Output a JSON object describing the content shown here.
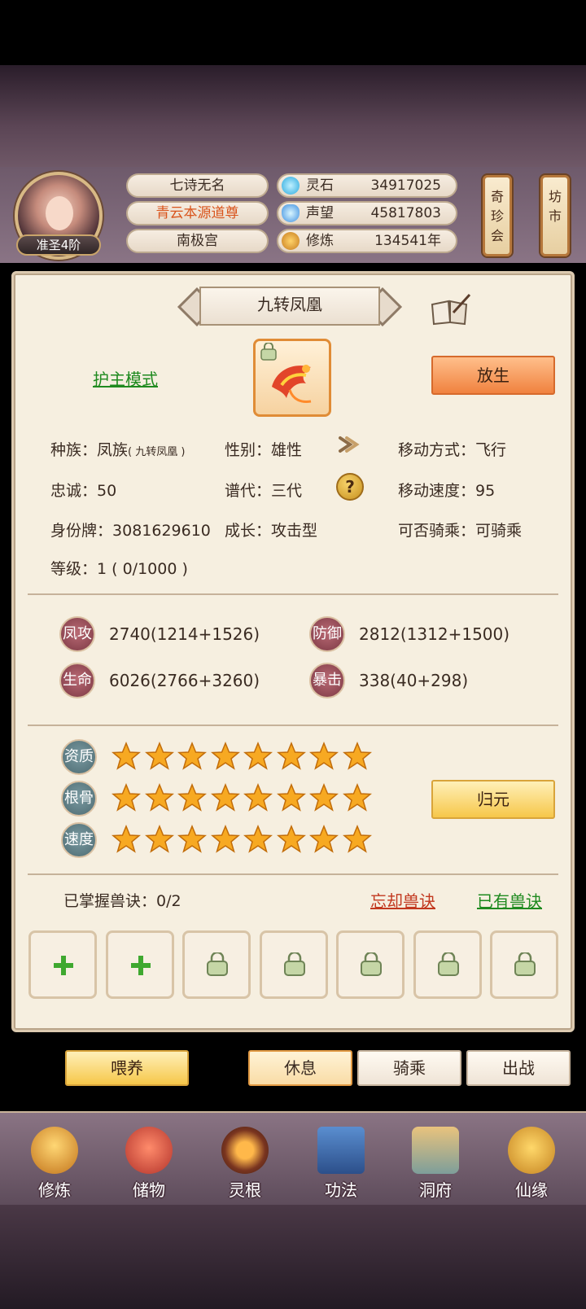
{
  "header": {
    "rank": "准圣4阶",
    "name": "七诗无名",
    "title": "青云本源道尊",
    "sect": "南极宫",
    "stats": [
      {
        "label": "灵石",
        "value": "34917025",
        "icon": "spirit-stone-icon"
      },
      {
        "label": "声望",
        "value": "45817803",
        "icon": "prestige-crystal-icon"
      },
      {
        "label": "修炼",
        "value": "134541年",
        "icon": "meditation-icon"
      }
    ],
    "shop_button": "奇珍会",
    "market_button": "坊市"
  },
  "pet": {
    "name": "九转凤凰",
    "guard_mode": "护主模式",
    "release_button": "放生",
    "race_label": "种族：",
    "race_value": "凤族",
    "race_sub": "( 九转凤凰 )",
    "gender_label": "性别：",
    "gender_value": "雄性",
    "move_mode_label": "移动方式：",
    "move_mode_value": "飞行",
    "loyalty_label": "忠诚：",
    "loyalty_value": "50",
    "generation_label": "谱代：",
    "generation_value": "三代",
    "move_speed_label": "移动速度：",
    "move_speed_value": "95",
    "id_label": "身份牌：",
    "id_value": "3081629610",
    "growth_label": "成长：",
    "growth_value": "攻击型",
    "ride_label": "可否骑乘：",
    "ride_value": "可骑乘",
    "level_label": "等级：",
    "level_value": "1 ( 0/1000 )"
  },
  "attributes": [
    {
      "label": "凤攻",
      "value": "2740(1214+1526)"
    },
    {
      "label": "防御",
      "value": "2812(1312+1500)"
    },
    {
      "label": "生命",
      "value": "6026(2766+3260)"
    },
    {
      "label": "暴击",
      "value": "338(40+298)"
    }
  ],
  "qualities": [
    {
      "label": "资质",
      "stars": 8
    },
    {
      "label": "根骨",
      "stars": 8
    },
    {
      "label": "速度",
      "stars": 8
    }
  ],
  "reset_button": "归元",
  "skills": {
    "mastered_label": "已掌握兽诀：0/2",
    "forget_link": "忘却兽诀",
    "owned_link": "已有兽诀",
    "slots": [
      "add",
      "add",
      "locked",
      "locked",
      "locked",
      "locked",
      "locked"
    ]
  },
  "actions": {
    "feed": "喂养",
    "rest": "休息",
    "ride": "骑乘",
    "fight": "出战"
  },
  "nav": [
    {
      "label": "修炼",
      "icon": "cultivation-icon"
    },
    {
      "label": "储物",
      "icon": "storage-bag-icon"
    },
    {
      "label": "灵根",
      "icon": "spirit-root-icon"
    },
    {
      "label": "功法",
      "icon": "technique-book-icon"
    },
    {
      "label": "洞府",
      "icon": "cave-mansion-icon"
    },
    {
      "label": "仙缘",
      "icon": "immortal-fate-icon"
    }
  ]
}
